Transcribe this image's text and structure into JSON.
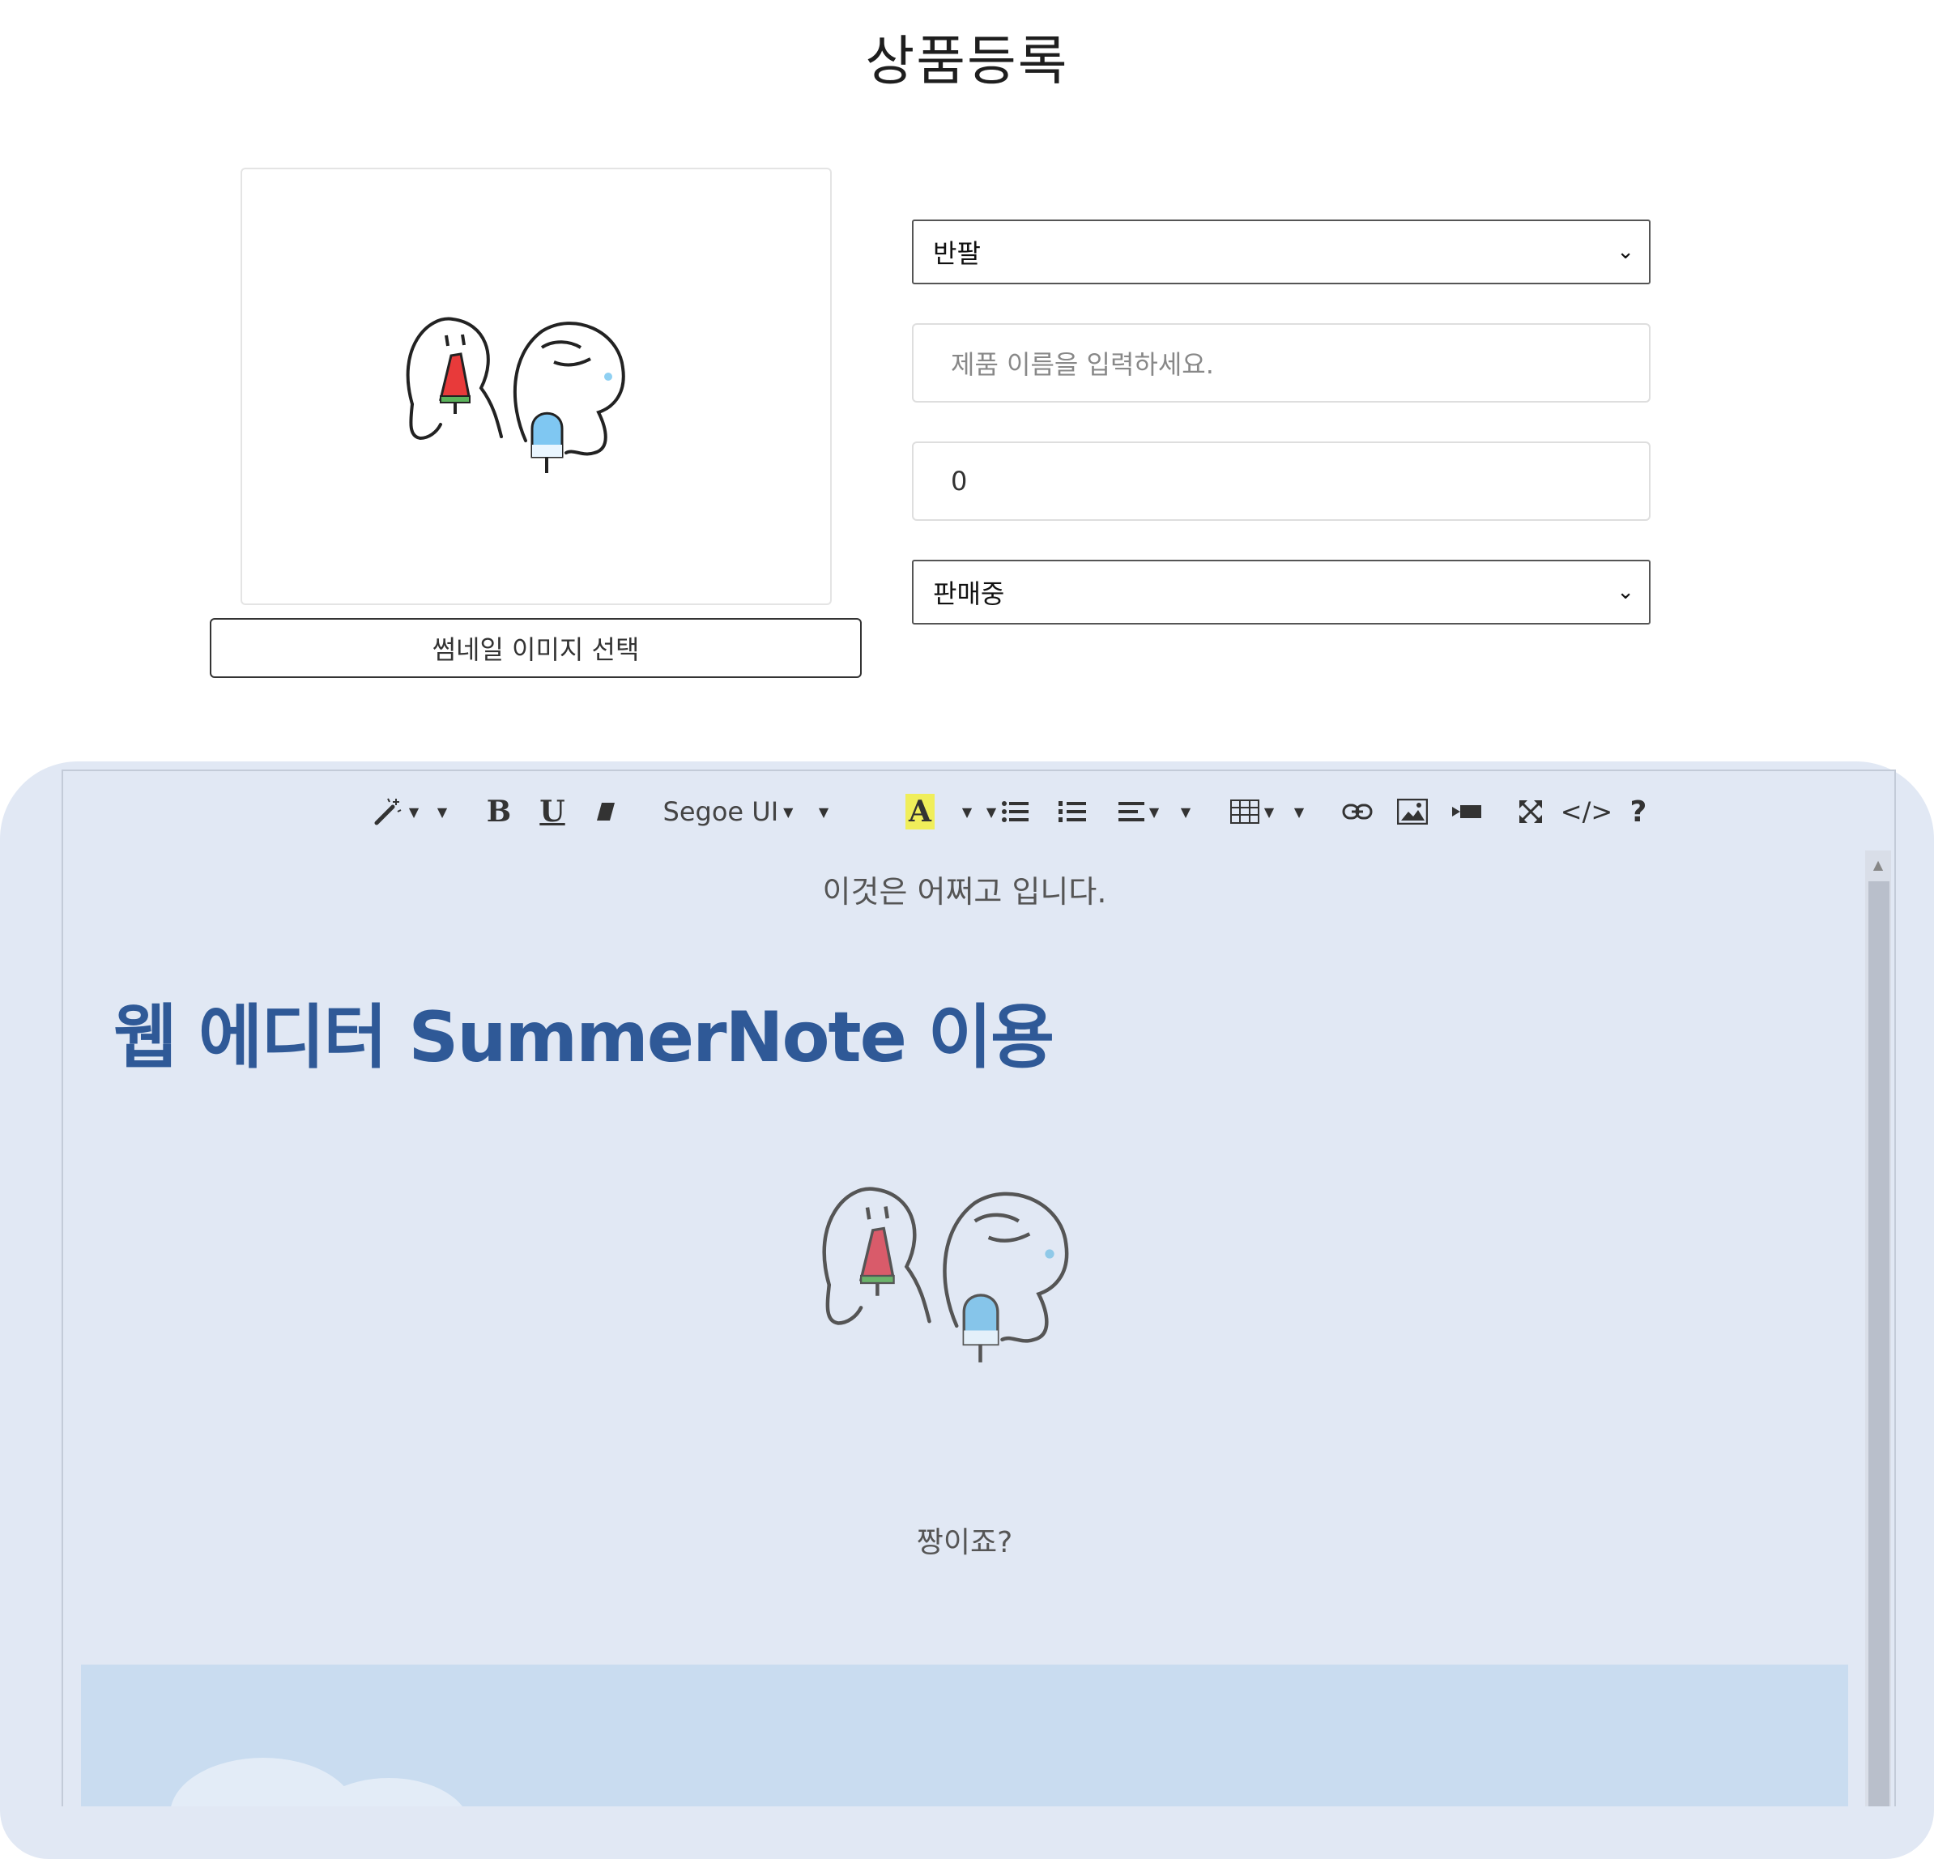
{
  "page": {
    "title": "상품등록"
  },
  "thumbnail": {
    "button_label": "썸네일 이미지 선택",
    "image": "two-characters-eating-popsicles"
  },
  "form": {
    "category_select": {
      "selected": "반팔"
    },
    "product_name": {
      "placeholder": "제품 이름을 입력하세요."
    },
    "price": {
      "value": "0"
    },
    "status_select": {
      "selected": "판매중"
    }
  },
  "editor": {
    "toolbar": {
      "style_icon": "magic-wand-icon",
      "bold_label": "B",
      "underline_label": "U",
      "clear_icon": "eraser-icon",
      "font_name": "Segoe UI",
      "color_label": "A",
      "unordered_list_icon": "unordered-list-icon",
      "ordered_list_icon": "ordered-list-icon",
      "align_icon": "align-icon",
      "table_icon": "table-icon",
      "link_icon": "link-icon",
      "picture_icon": "picture-icon",
      "video_icon": "video-icon",
      "fullscreen_icon": "fullscreen-icon",
      "code_label": "</>",
      "help_label": "?"
    },
    "content": {
      "line1": "이것은 어쩌고 입니다.",
      "heading": "웹 에디터 SummerNote 이용",
      "line2": "짱이죠?"
    },
    "colors": {
      "panel_bg": "#e1e8f4",
      "heading": "#2f5997",
      "color_highlight": "#f0ee5a"
    }
  }
}
